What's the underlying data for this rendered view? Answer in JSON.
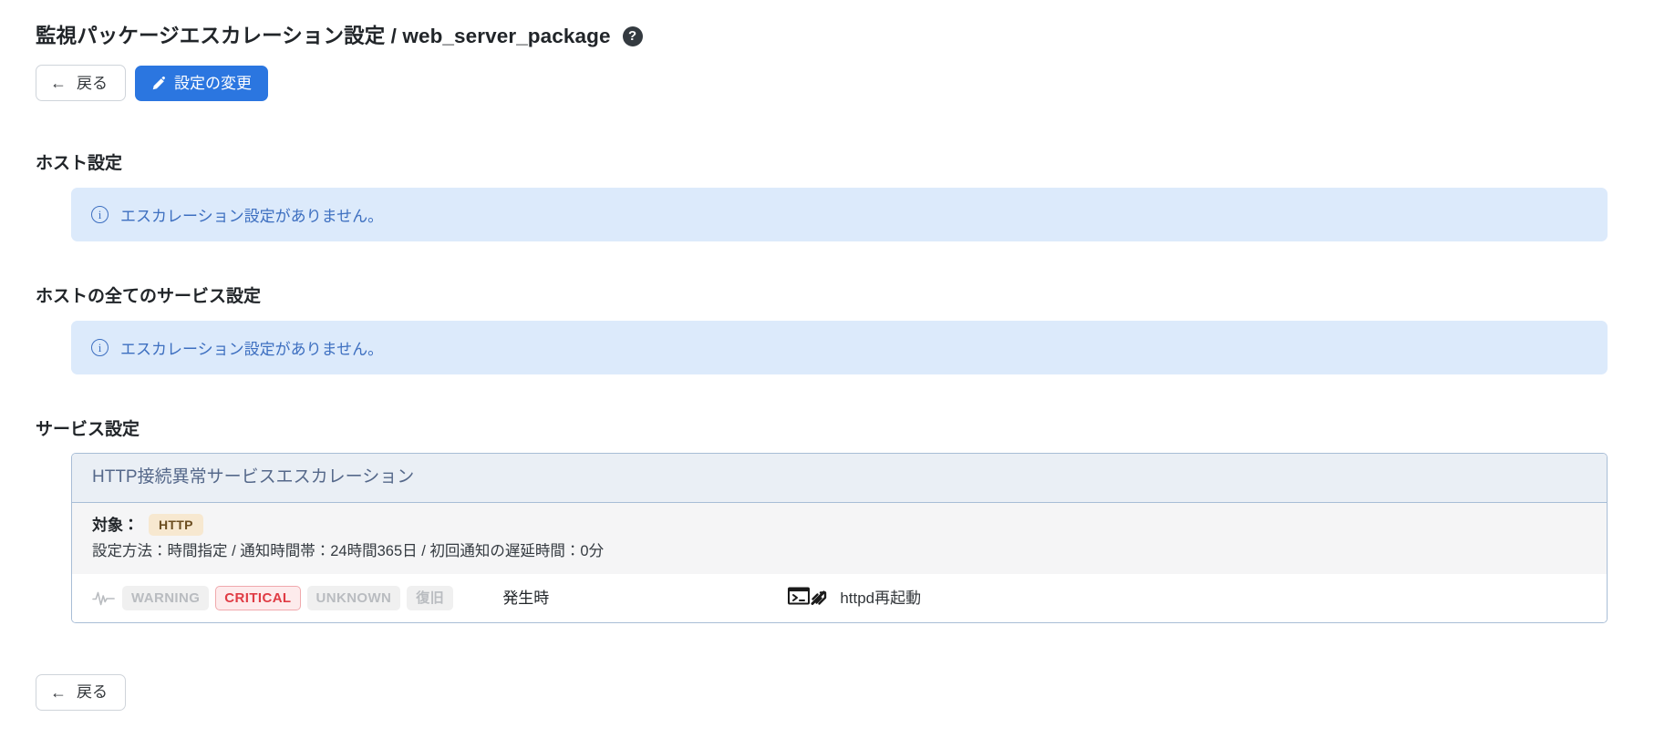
{
  "header": {
    "title": "監視パッケージエスカレーション設定 / web_server_package",
    "help_icon": "help-circle-icon",
    "help_label": "?"
  },
  "toolbar": {
    "back_label": "戻る",
    "back_arrow": "←",
    "edit_label": "設定の変更",
    "edit_icon": "pencil-icon"
  },
  "sections": [
    {
      "heading": "ホスト設定",
      "alert": {
        "icon": "info-circle-icon",
        "icon_glyph": "i",
        "text": "エスカレーション設定がありません。"
      }
    },
    {
      "heading": "ホストの全てのサービス設定",
      "alert": {
        "icon": "info-circle-icon",
        "icon_glyph": "i",
        "text": "エスカレーション設定がありません。"
      }
    }
  ],
  "service_section": {
    "heading": "サービス設定",
    "card": {
      "title": "HTTP接続異常サービスエスカレーション",
      "target_label": "対象：",
      "target_badge": "HTTP",
      "detail": "設定方法：時間指定 / 通知時間帯：24時間365日 / 初回通知の遅延時間：0分",
      "row": {
        "pulse_icon": "pulse-waveform-icon",
        "states": [
          {
            "label": "WARNING",
            "active": false
          },
          {
            "label": "CRITICAL",
            "active": true
          },
          {
            "label": "UNKNOWN",
            "active": false
          },
          {
            "label": "復旧",
            "active": false
          }
        ],
        "timing": "発生時",
        "action_icon": "terminal-escalation-icon",
        "action_label": "httpd再起動"
      }
    }
  },
  "footer": {
    "back_label": "戻る",
    "back_arrow": "←"
  },
  "colors": {
    "primary": "#2b76e0",
    "alert_bg": "#dceafb",
    "alert_text": "#3d6fc0",
    "card_border": "#a8bdd6",
    "card_header_bg": "#eaeff5",
    "card_header_text": "#55688a",
    "badge_bg": "#f7e8d0",
    "badge_text": "#6b4d20",
    "critical": "#e03b44",
    "muted_chip": "#b9bcc0"
  }
}
